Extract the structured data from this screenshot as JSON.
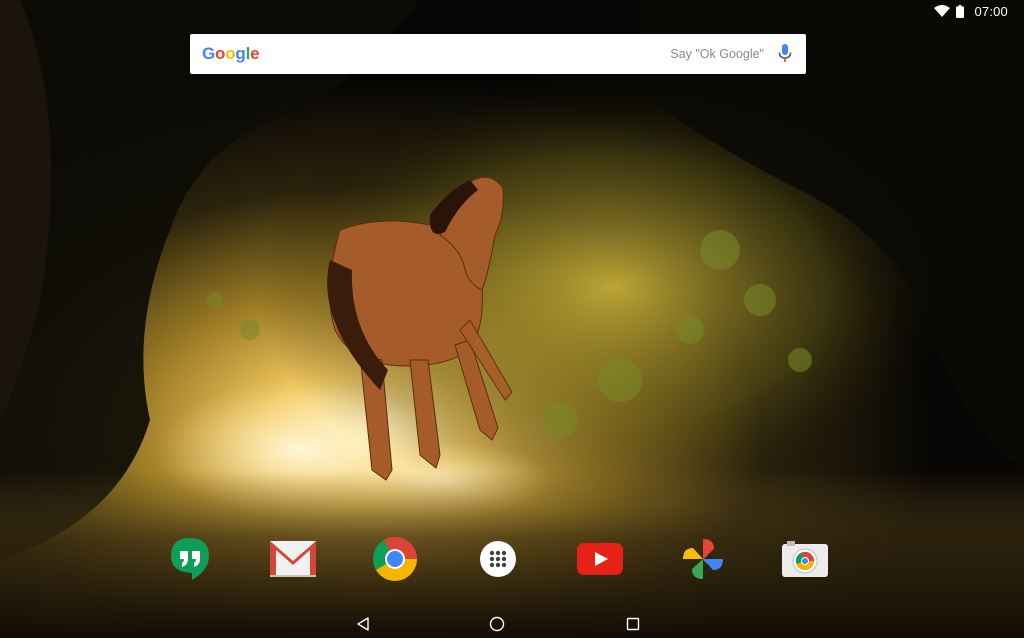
{
  "status_bar": {
    "time": "07:00"
  },
  "search": {
    "logo_letters": [
      {
        "ch": "G",
        "color": "#4285F4"
      },
      {
        "ch": "o",
        "color": "#EA4335"
      },
      {
        "ch": "o",
        "color": "#FBBC05"
      },
      {
        "ch": "g",
        "color": "#4285F4"
      },
      {
        "ch": "l",
        "color": "#34A853"
      },
      {
        "ch": "e",
        "color": "#EA4335"
      }
    ],
    "hint": "Say \"Ok Google\""
  },
  "dock": {
    "apps": [
      "hangouts-icon",
      "gmail-icon",
      "chrome-icon",
      "app-drawer-icon",
      "youtube-icon",
      "google-photos-icon",
      "camera-icon"
    ]
  },
  "navigation": {
    "buttons": [
      "back-icon",
      "home-icon",
      "recents-icon"
    ]
  },
  "colors": {
    "hangouts": "#0F9D58",
    "gmail_red": "#D44638",
    "youtube": "#E62117",
    "search_hint": "#8A8A8A"
  }
}
